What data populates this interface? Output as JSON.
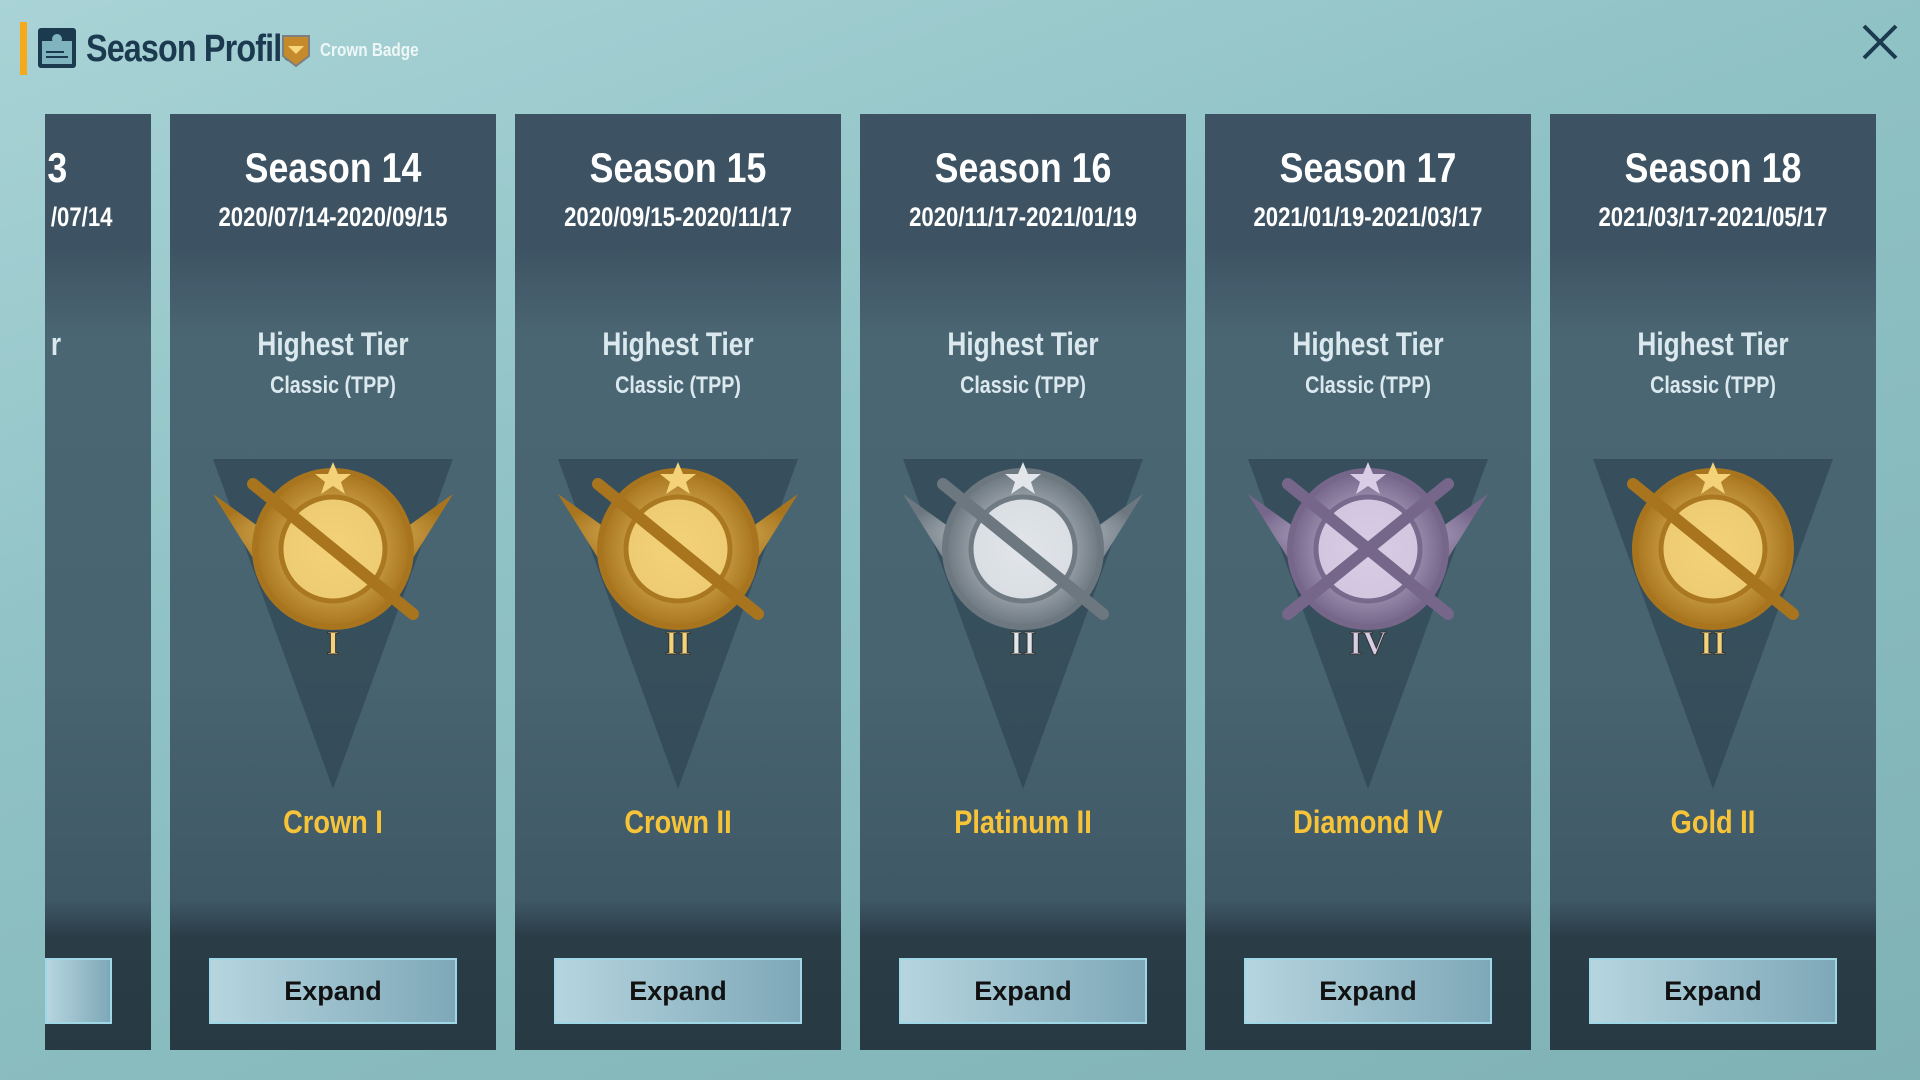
{
  "header": {
    "title": "Season Profile",
    "badge_label": "Crown Badge",
    "accent": "#f5a91b"
  },
  "partial_card": {
    "season": "3",
    "dates": "/07/14",
    "highest_tier": "r"
  },
  "cards": [
    {
      "season": "Season 14",
      "dates": "2020/07/14-2020/09/15",
      "highest_tier": "Highest Tier",
      "mode": "Classic (TPP)",
      "tier": "Crown I",
      "numeral": "I",
      "metal": "gold",
      "expand": "Expand"
    },
    {
      "season": "Season 15",
      "dates": "2020/09/15-2020/11/17",
      "highest_tier": "Highest Tier",
      "mode": "Classic (TPP)",
      "tier": "Crown II",
      "numeral": "II",
      "metal": "gold",
      "expand": "Expand"
    },
    {
      "season": "Season 16",
      "dates": "2020/11/17-2021/01/19",
      "highest_tier": "Highest Tier",
      "mode": "Classic (TPP)",
      "tier": "Platinum II",
      "numeral": "II",
      "metal": "silver",
      "expand": "Expand"
    },
    {
      "season": "Season 17",
      "dates": "2021/01/19-2021/03/17",
      "highest_tier": "Highest Tier",
      "mode": "Classic (TPP)",
      "tier": "Diamond IV",
      "numeral": "IV",
      "metal": "purple",
      "expand": "Expand"
    },
    {
      "season": "Season 18",
      "dates": "2021/03/17-2021/05/17",
      "highest_tier": "Highest Tier",
      "mode": "Classic (TPP)",
      "tier": "Gold II",
      "numeral": "II",
      "metal": "gold",
      "expand": "Expand"
    }
  ],
  "colors": {
    "gold": [
      "#f3d27a",
      "#a8751e"
    ],
    "silver": [
      "#e2e6ea",
      "#6c7780"
    ],
    "purple": [
      "#d9cde6",
      "#75668a"
    ],
    "tier_text": "#f7c439"
  }
}
